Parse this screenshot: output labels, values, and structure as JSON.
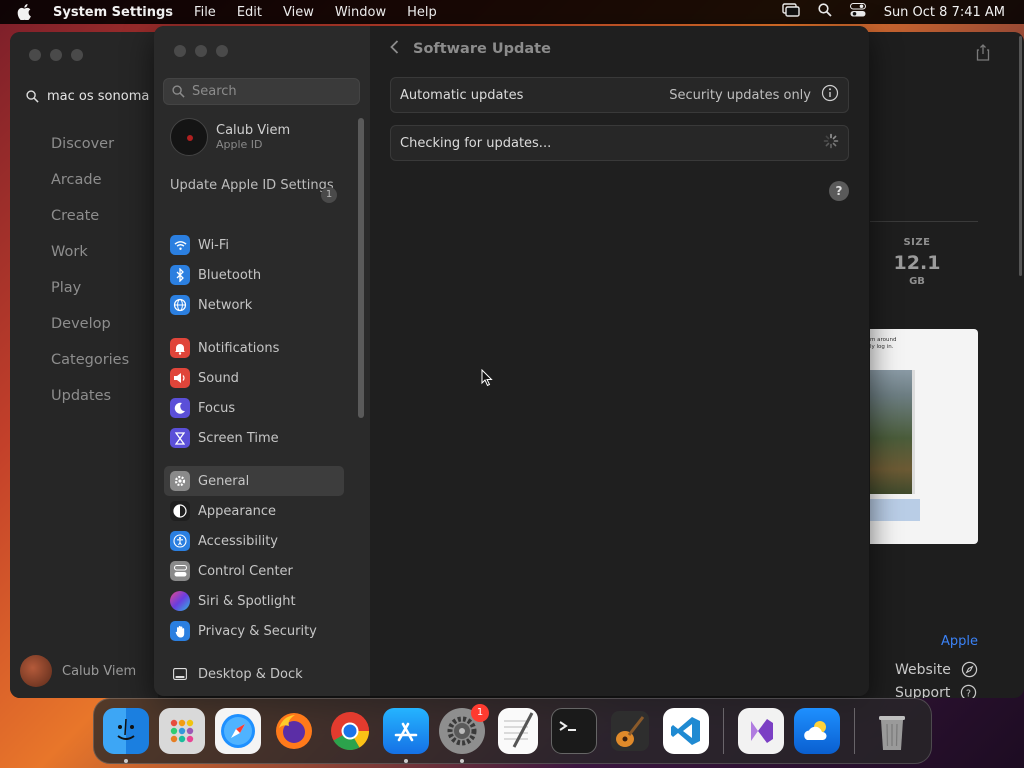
{
  "menubar": {
    "app_name": "System Settings",
    "menus": [
      "File",
      "Edit",
      "View",
      "Window",
      "Help"
    ],
    "clock": "Sun Oct 8  7:41 AM"
  },
  "appstore": {
    "search_value": "mac os sonoma",
    "nav": [
      "Discover",
      "Arcade",
      "Create",
      "Work",
      "Play",
      "Develop",
      "Categories",
      "Updates"
    ],
    "user_name": "Calub Viem",
    "size_label": "SIZE",
    "size_value": "12.1",
    "size_unit": "GB",
    "preview_text": "m around\nly log in.",
    "developer_link": "Apple",
    "website_label": "Website",
    "support_label": "Support"
  },
  "settings": {
    "search_placeholder": "Search",
    "account_name": "Calub Viem",
    "account_sub": "Apple ID",
    "update_apple_id": "Update Apple ID Settings",
    "update_badge": "1",
    "sidebar_items": [
      {
        "label": "Wi-Fi",
        "icon": "wifi-icon",
        "color": "#2b7fe0"
      },
      {
        "label": "Bluetooth",
        "icon": "bluetooth-icon",
        "color": "#2b7fe0"
      },
      {
        "label": "Network",
        "icon": "globe-icon",
        "color": "#2b7fe0"
      },
      {
        "label": "Notifications",
        "icon": "bell-icon",
        "color": "#e0453a"
      },
      {
        "label": "Sound",
        "icon": "speaker-icon",
        "color": "#e0453a"
      },
      {
        "label": "Focus",
        "icon": "moon-icon",
        "color": "#5b4fd8"
      },
      {
        "label": "Screen Time",
        "icon": "hourglass-icon",
        "color": "#5b4fd8"
      },
      {
        "label": "General",
        "icon": "gear-icon",
        "color": "#8a8a8a"
      },
      {
        "label": "Appearance",
        "icon": "appearance-icon",
        "color": "#1f1f1f"
      },
      {
        "label": "Accessibility",
        "icon": "accessibility-icon",
        "color": "#2b7fe0"
      },
      {
        "label": "Control Center",
        "icon": "control-center-icon",
        "color": "#8a8a8a"
      },
      {
        "label": "Siri & Spotlight",
        "icon": "siri-icon",
        "color": "#b040c0"
      },
      {
        "label": "Privacy & Security",
        "icon": "hand-icon",
        "color": "#2b7fe0"
      },
      {
        "label": "Desktop & Dock",
        "icon": "dock-icon",
        "color": "#2a2a2a"
      }
    ],
    "page_title": "Software Update",
    "automatic_updates_label": "Automatic updates",
    "automatic_updates_value": "Security updates only",
    "checking_label": "Checking for updates...",
    "help_label": "?"
  },
  "dock": {
    "apps": [
      "Finder",
      "Launchpad",
      "Safari",
      "Firefox",
      "Chrome",
      "App Store",
      "System Settings",
      "TextEdit",
      "Terminal",
      "GarageBand",
      "Visual Studio Code",
      "Visual Studio",
      "Weather",
      "Trash"
    ],
    "settings_badge": "1"
  }
}
